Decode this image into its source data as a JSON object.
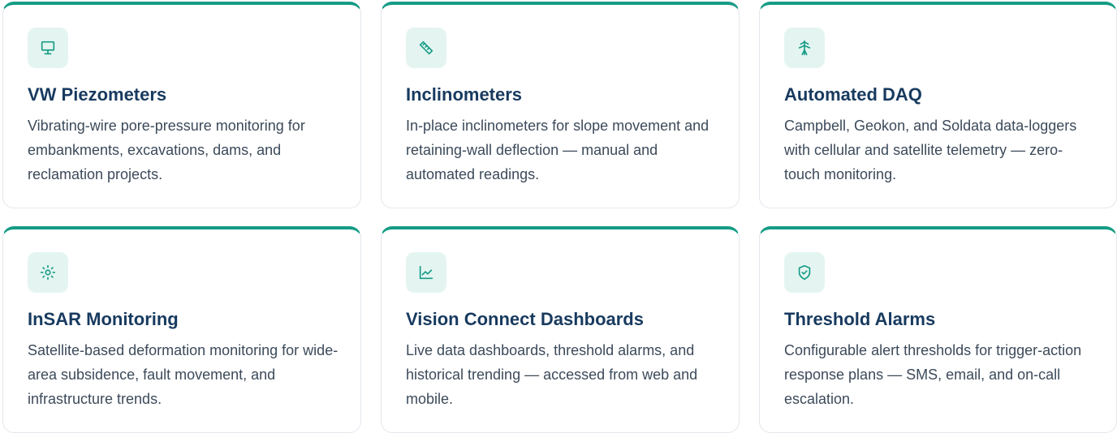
{
  "accent_color": "#169c86",
  "cards": [
    {
      "icon": "monitor-icon",
      "title": "VW Piezometers",
      "description": "Vibrating-wire pore-pressure monitoring for embankments, excavations, dams, and reclamation projects."
    },
    {
      "icon": "ruler-icon",
      "title": "Inclinometers",
      "description": "In-place inclinometers for slope movement and retaining-wall deflection — manual and automated readings."
    },
    {
      "icon": "antenna-icon",
      "title": "Automated DAQ",
      "description": "Campbell, Geokon, and Soldata data-loggers with cellular and satellite telemetry — zero-touch monitoring."
    },
    {
      "icon": "sun-icon",
      "title": "InSAR Monitoring",
      "description": "Satellite-based deformation monitoring for wide-area subsidence, fault movement, and infrastructure trends."
    },
    {
      "icon": "line-chart-icon",
      "title": "Vision Connect Dashboards",
      "description": "Live data dashboards, threshold alarms, and historical trending — accessed from web and mobile."
    },
    {
      "icon": "shield-check-icon",
      "title": "Threshold Alarms",
      "description": "Configurable alert thresholds for trigger-action response plans — SMS, email, and on-call escalation."
    }
  ]
}
